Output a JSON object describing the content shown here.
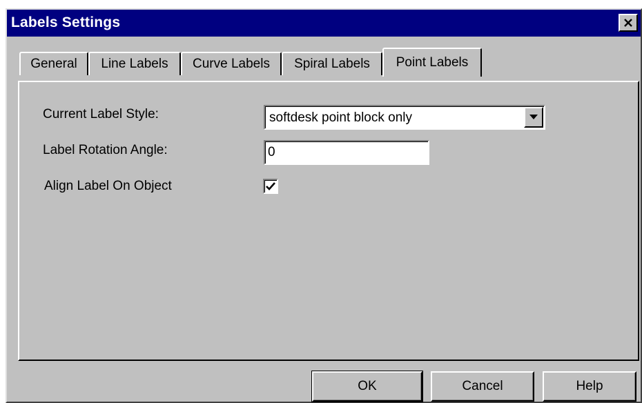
{
  "window": {
    "title": "Labels Settings",
    "close_icon": "close-icon"
  },
  "tabs": [
    {
      "label": "General",
      "active": false
    },
    {
      "label": "Line Labels",
      "active": false
    },
    {
      "label": "Curve Labels",
      "active": false
    },
    {
      "label": "Spiral Labels",
      "active": false
    },
    {
      "label": "Point Labels",
      "active": true
    }
  ],
  "form": {
    "label_style_label": "Current Label Style:",
    "label_style_value": "softdesk point block only",
    "rotation_label": "Label Rotation Angle:",
    "rotation_value": "0",
    "align_label": "Align Label On Object",
    "align_checked": true
  },
  "buttons": {
    "ok": "OK",
    "cancel": "Cancel",
    "help": "Help"
  },
  "colors": {
    "titlebar": "#000080",
    "face": "#c0c0c0"
  }
}
